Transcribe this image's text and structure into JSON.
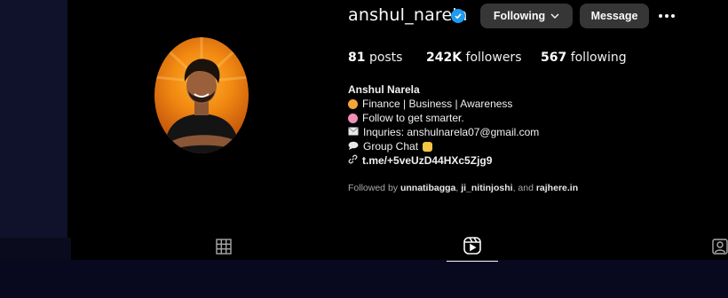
{
  "profile": {
    "username": "anshul_narela",
    "display_name": "Anshul Narela",
    "verified": true
  },
  "actions": {
    "following_label": "Following",
    "message_label": "Message"
  },
  "stats": {
    "posts_count": "81",
    "posts_label": "posts",
    "followers_count": "242K",
    "followers_label": "followers",
    "following_count": "567",
    "following_label": "following"
  },
  "bio": {
    "line1": "Finance | Business | Awareness",
    "line2": "Follow to get smarter.",
    "line3": "Inquries: anshulnarela07@gmail.com",
    "line4": "Group Chat",
    "link": "t.me/+5veUzD44HXc5Zjg9"
  },
  "followed_by": {
    "prefix": "Followed by",
    "user1": "unnatibagga",
    "user2": "ji_nitinjoshi",
    "conjunction": ", and",
    "user3": "rajhere.in"
  },
  "icons": {
    "verified": "verified-badge-icon",
    "chevron": "chevron-down-icon",
    "more": "more-options-icon",
    "posts_tab": "grid-icon",
    "reels_tab": "reels-icon",
    "tagged_tab": "tagged-icon"
  },
  "colors": {
    "background": "#000000",
    "button": "#363636",
    "verified": "#1d9bf0",
    "muted_text": "#a8a8a8"
  }
}
